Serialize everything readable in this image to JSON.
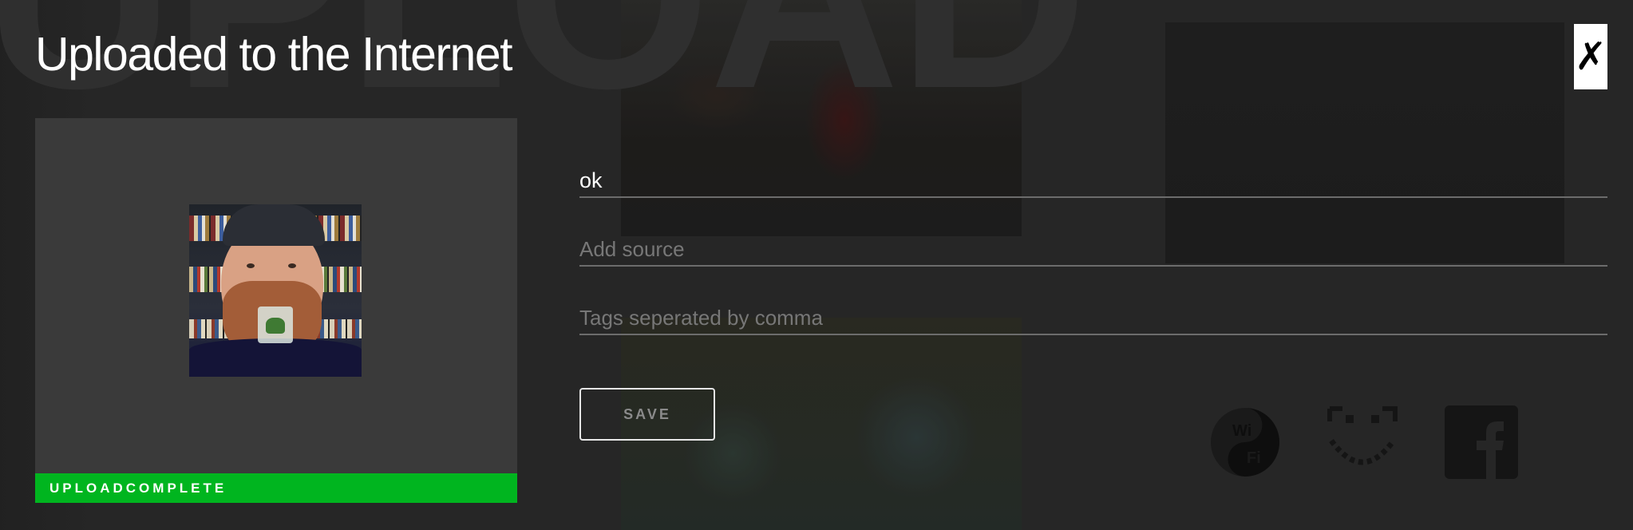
{
  "background": {
    "word": "UPLOAD"
  },
  "modal": {
    "title": "Uploaded to the Internet",
    "close_icon": "close-x-icon",
    "status": "UPLOADCOMPLETE",
    "status_color": "#00b51f"
  },
  "form": {
    "title_value": "ok",
    "source_placeholder": "Add source",
    "tags_placeholder": "Tags seperated by comma",
    "save_label": "SAVE"
  },
  "share": {
    "icons": [
      "wifi-yin-yang-icon",
      "smiley-face-icon",
      "facebook-icon"
    ]
  }
}
